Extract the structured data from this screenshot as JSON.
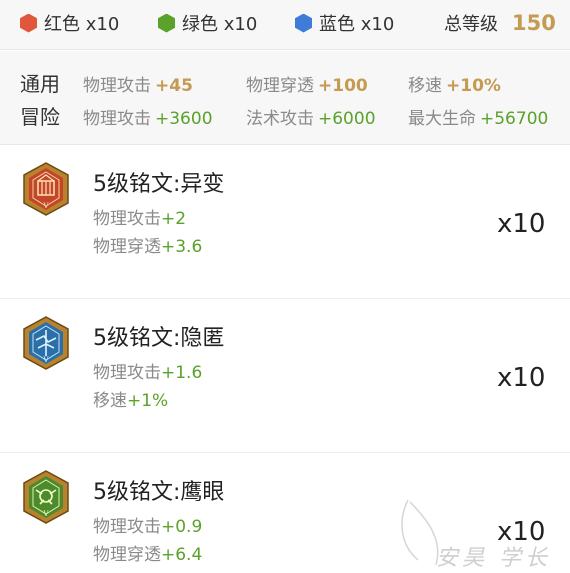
{
  "summary": {
    "red": {
      "label": "红色 x10",
      "color": "#e0573c"
    },
    "green": {
      "label": "绿色 x10",
      "color": "#5aa22a"
    },
    "blue": {
      "label": "蓝色 x10",
      "color": "#3f7bd8"
    },
    "total_label": "总等级",
    "total_value": "150"
  },
  "stats": {
    "general_label": "通用",
    "adventure_label": "冒险",
    "general": [
      {
        "name": "物理攻击",
        "value": "+45"
      },
      {
        "name": "物理穿透",
        "value": "+100"
      },
      {
        "name": "移速",
        "value": "+10%"
      }
    ],
    "adventure": [
      {
        "name": "物理攻击",
        "value": "+3600"
      },
      {
        "name": "法术攻击",
        "value": "+6000"
      },
      {
        "name": "最大生命",
        "value": "+56700"
      }
    ]
  },
  "runes": [
    {
      "name": "5级铭文:异变",
      "color": "red",
      "icon": "rune-red-emblem-icon",
      "stats": [
        {
          "name": "物理攻击",
          "value": "+2"
        },
        {
          "name": "物理穿透",
          "value": "+3.6"
        }
      ],
      "count": "x10"
    },
    {
      "name": "5级铭文:隐匿",
      "color": "blue",
      "icon": "rune-blue-emblem-icon",
      "stats": [
        {
          "name": "物理攻击",
          "value": "+1.6"
        },
        {
          "name": "移速",
          "value": "+1%"
        }
      ],
      "count": "x10"
    },
    {
      "name": "5级铭文:鹰眼",
      "color": "green",
      "icon": "rune-green-emblem-icon",
      "stats": [
        {
          "name": "物理攻击",
          "value": "+0.9"
        },
        {
          "name": "物理穿透",
          "value": "+6.4"
        }
      ],
      "count": "x10"
    }
  ],
  "watermark": "安昊 学长"
}
